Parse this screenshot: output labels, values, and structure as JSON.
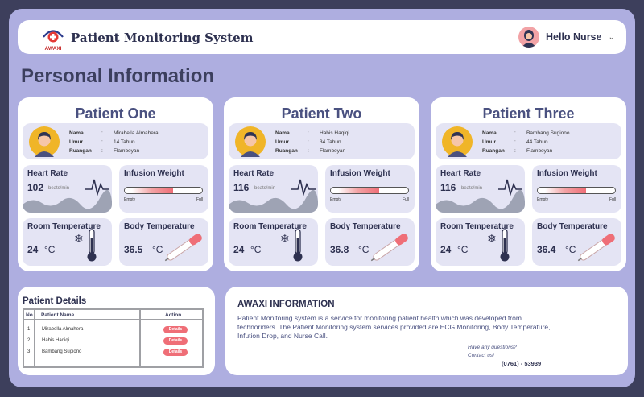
{
  "header": {
    "logo_text": "AWAXI",
    "app_title": "Patient Monitoring System",
    "user_greeting": "Hello Nurse",
    "user_avatar_icon": "nurse-avatar-icon",
    "dropdown_icon": "chevron-down-icon"
  },
  "page_title": "Personal Information",
  "labels": {
    "nama": "Nama",
    "umur": "Umur",
    "ruangan": "Ruangan",
    "colon": ":",
    "heart_rate": "Heart Rate",
    "beats_unit": "beats/min",
    "infusion_weight": "Infusion Weight",
    "empty": "Empty",
    "full": "Full",
    "room_temperature": "Room Temperature",
    "body_temperature": "Body Temperature",
    "celsius": "°C"
  },
  "patients": [
    {
      "title": "Patient One",
      "nama": "Mirabella Almahera",
      "umur": "14 Tahun",
      "ruangan": "Flamboyan",
      "heart_rate": "102",
      "infusion_level": 0.62,
      "room_temp": "24",
      "body_temp": "36.5"
    },
    {
      "title": "Patient Two",
      "nama": "Habis Haqiqi",
      "umur": "34 Tahun",
      "ruangan": "Flamboyan",
      "heart_rate": "116",
      "infusion_level": 0.62,
      "room_temp": "24",
      "body_temp": "36.8"
    },
    {
      "title": "Patient Three",
      "nama": "Bambang Sugiono",
      "umur": "44 Tahun",
      "ruangan": "Flamboyan",
      "heart_rate": "116",
      "infusion_level": 0.62,
      "room_temp": "24",
      "body_temp": "36.4"
    }
  ],
  "details": {
    "title": "Patient Details",
    "columns": [
      "No",
      "Patient Name",
      "Action"
    ],
    "rows": [
      {
        "no": "1",
        "name": "Mirabella Almahera",
        "action": "Details"
      },
      {
        "no": "2",
        "name": "Habis Haqiqi",
        "action": "Details"
      },
      {
        "no": "3",
        "name": "Bambang Sugiono",
        "action": "Details"
      }
    ]
  },
  "awaxi": {
    "title": "AWAXI INFORMATION",
    "description": "Patient Monitoring system is a service for monitoring patient health which was developed from technoriders. The Patient Monitoring system services provided are ECG Monitoring, Body Temperature, Infution Drop, and Nurse Call.",
    "question": "Have any questions?",
    "contact": "Contact us!",
    "phone": "(0761) - 53939"
  },
  "colors": {
    "background": "#aeaee0",
    "accent": "#ef6e77",
    "primary_text": "#2e3150",
    "tile": "#e4e4f4"
  }
}
